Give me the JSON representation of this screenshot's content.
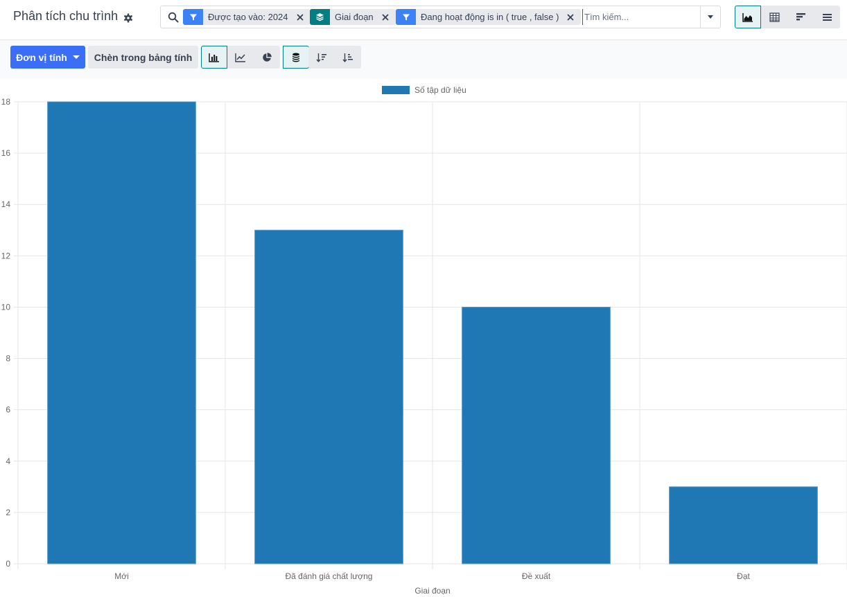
{
  "header": {
    "title": "Phân tích chu trình"
  },
  "search": {
    "facets": [
      {
        "label": "Được tạo vào: 2024",
        "type": "filter"
      },
      {
        "label": "Giai đoạn",
        "type": "groupby"
      },
      {
        "label": "Đang hoạt động is in ( true , false )",
        "type": "filter"
      }
    ],
    "placeholder": "Tìm kiếm..."
  },
  "views": [
    "graph-view",
    "pivot-view",
    "cohort-view",
    "list-view"
  ],
  "toolbar": {
    "measure_label": "Đơn vị tính",
    "insert_label": "Chèn trong bảng tính"
  },
  "colors": {
    "bar": "#1f77b4",
    "primary": "#3b6ef7",
    "accent": "#017e84"
  },
  "chart_data": {
    "type": "bar",
    "categories": [
      "Mới",
      "Đã đánh giá chất lượng",
      "Đề xuất",
      "Đạt"
    ],
    "series": [
      {
        "name": "Số tập dữ liệu",
        "values": [
          18,
          13,
          10,
          3
        ]
      }
    ],
    "xlabel": "Giai đoạn",
    "ylabel": "",
    "ylim": [
      0,
      18
    ],
    "yticks": [
      0,
      2,
      4,
      6,
      8,
      10,
      12,
      14,
      16,
      18
    ],
    "grid": true,
    "legend": "top-center"
  }
}
